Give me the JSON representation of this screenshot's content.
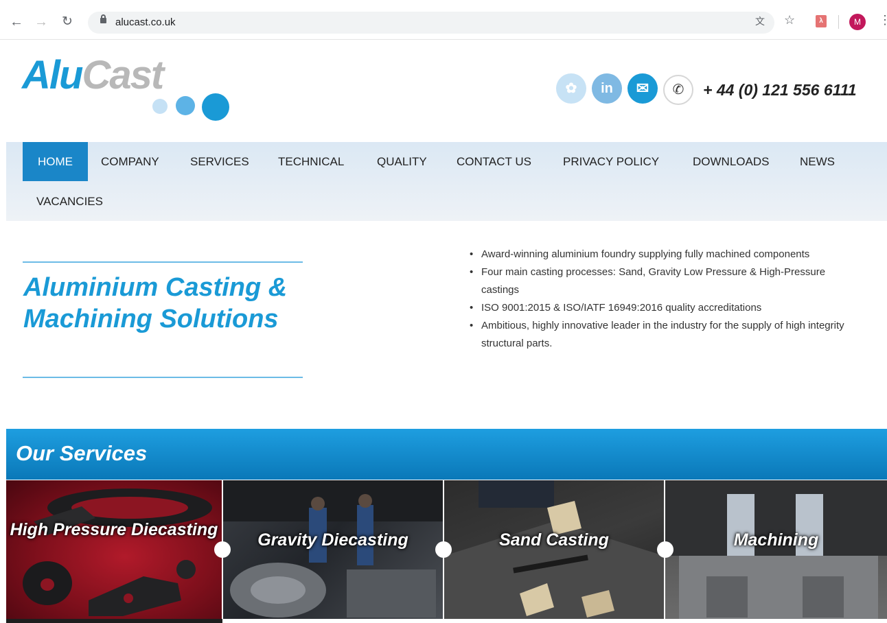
{
  "browser": {
    "url": "alucast.co.uk",
    "profile_initial": "M"
  },
  "logo": {
    "part1": "Alu",
    "part2": "Cast"
  },
  "header": {
    "social": [
      "twitter-icon",
      "linkedin-icon",
      "email-icon"
    ],
    "linkedin_label": "in",
    "phone": "+ 44 (0) 121 556 6111"
  },
  "nav": {
    "items": [
      {
        "label": "HOME",
        "active": true
      },
      {
        "label": "COMPANY"
      },
      {
        "label": "SERVICES"
      },
      {
        "label": "TECHNICAL"
      },
      {
        "label": "QUALITY"
      },
      {
        "label": "CONTACT US"
      },
      {
        "label": "PRIVACY POLICY"
      },
      {
        "label": "DOWNLOADS"
      },
      {
        "label": "NEWS"
      },
      {
        "label": "VACANCIES"
      }
    ]
  },
  "hero": {
    "title": "Aluminium Casting & Machining Solutions",
    "bullets": [
      "Award-winning aluminium foundry supplying fully machined components",
      "Four main casting processes: Sand, Gravity Low Pressure & High-Pressure castings",
      "ISO 9001:2015 & ISO/IATF 16949:2016 quality accreditations",
      "Ambitious, highly innovative leader in the industry for the supply of high integrity structural parts."
    ]
  },
  "services": {
    "title": "Our Services",
    "items": [
      {
        "label": "High Pressure Diecasting"
      },
      {
        "label": "Gravity Diecasting"
      },
      {
        "label": "Sand Casting"
      },
      {
        "label": "Machining"
      }
    ]
  },
  "colors": {
    "brand_blue": "#1a9ad6",
    "nav_active": "#1a86c8",
    "logo_grey": "#b8b8b8"
  }
}
